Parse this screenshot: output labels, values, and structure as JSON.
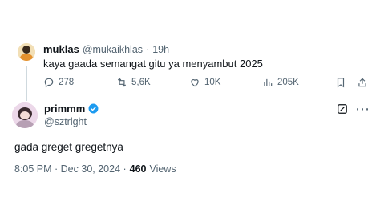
{
  "reply_to": {
    "name": "muklas",
    "handle": "@mukaikhlas",
    "separator": "·",
    "time": "19h",
    "text": "kaya gaada semangat gitu ya menyambut 2025",
    "actions": [
      {
        "icon": "reply-icon",
        "count": "278"
      },
      {
        "icon": "retweet-icon",
        "count": "5,6K"
      },
      {
        "icon": "like-icon",
        "count": "10K"
      },
      {
        "icon": "views-icon",
        "count": "205K"
      }
    ]
  },
  "main_tweet": {
    "name": "primmm",
    "handle": "@sztrlght",
    "verified_icon": "verified-badge-icon",
    "text": "gada greget gregetnya",
    "timestamp": "8:05 PM · Dec 30, 2024 ·",
    "views_count": "460",
    "views_label": "Views"
  },
  "colors": {
    "text": "#0f1419",
    "muted": "#536471",
    "verified": "#1d9bf0",
    "thread_line": "#cfd9de"
  }
}
